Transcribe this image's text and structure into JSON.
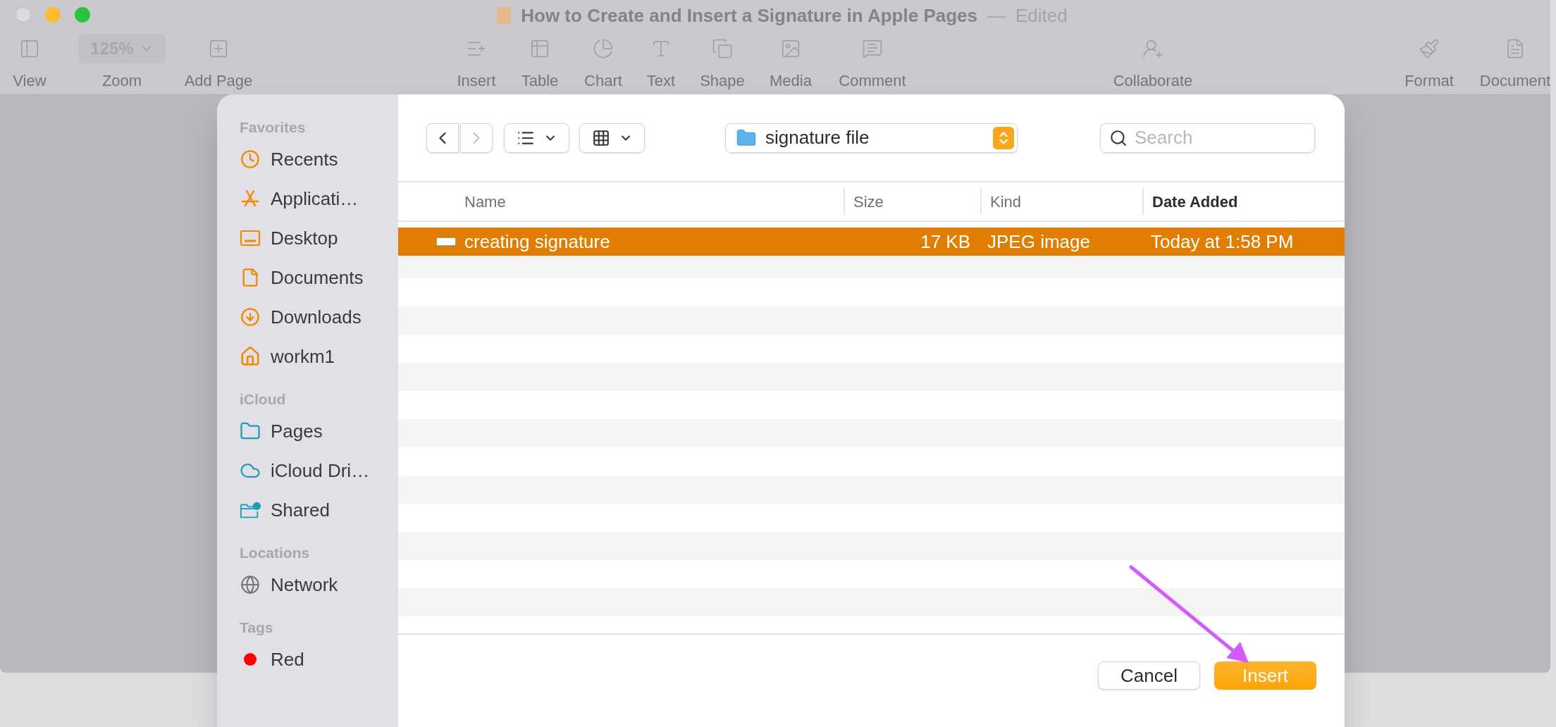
{
  "window": {
    "title": "How to Create and Insert a Signature in Apple Pages",
    "separator": "—",
    "status": "Edited"
  },
  "toolbar": {
    "items": [
      {
        "kind": "button",
        "label": "View"
      },
      {
        "kind": "dropdown",
        "label": "Zoom",
        "value": "125%"
      },
      {
        "kind": "button",
        "label": "Add Page"
      },
      {
        "kind": "button",
        "label": "Insert"
      },
      {
        "kind": "button",
        "label": "Table"
      },
      {
        "kind": "button",
        "label": "Chart"
      },
      {
        "kind": "button",
        "label": "Text"
      },
      {
        "kind": "button",
        "label": "Shape"
      },
      {
        "kind": "button",
        "label": "Media"
      },
      {
        "kind": "button",
        "label": "Comment"
      },
      {
        "kind": "button",
        "label": "Collaborate"
      },
      {
        "kind": "button",
        "label": "Format"
      },
      {
        "kind": "button",
        "label": "Document"
      }
    ]
  },
  "dialog": {
    "sidebar": {
      "sections": [
        {
          "heading": "Favorites",
          "items": [
            {
              "label": "Recents"
            },
            {
              "label": "Applicati…"
            },
            {
              "label": "Desktop"
            },
            {
              "label": "Documents"
            },
            {
              "label": "Downloads"
            },
            {
              "label": "workm1"
            }
          ]
        },
        {
          "heading": "iCloud",
          "items": [
            {
              "label": "Pages"
            },
            {
              "label": "iCloud Dri…"
            },
            {
              "label": "Shared"
            }
          ]
        },
        {
          "heading": "Locations",
          "items": [
            {
              "label": "Network"
            }
          ]
        },
        {
          "heading": "Tags",
          "items": [
            {
              "label": "Red",
              "color": "#ff0000"
            }
          ]
        }
      ]
    },
    "navigation": {
      "back": {
        "disabled": false
      },
      "forward": {
        "disabled": true
      }
    },
    "location": {
      "label": "signature file"
    },
    "search": {
      "placeholder": "Search"
    },
    "table": {
      "columns": [
        {
          "label": "Name",
          "selected": false
        },
        {
          "label": "Size",
          "selected": false
        },
        {
          "label": "Kind",
          "selected": false
        },
        {
          "label": "Date Added",
          "selected": true
        }
      ],
      "rows": [
        {
          "name": "creating signature",
          "size": "17 KB",
          "kind": "JPEG image",
          "date_added": "Today at 1:58 PM",
          "selected": true
        }
      ]
    },
    "buttons": [
      {
        "kind": "secondary",
        "label": "Cancel"
      },
      {
        "kind": "primary",
        "label": "Insert"
      }
    ]
  }
}
